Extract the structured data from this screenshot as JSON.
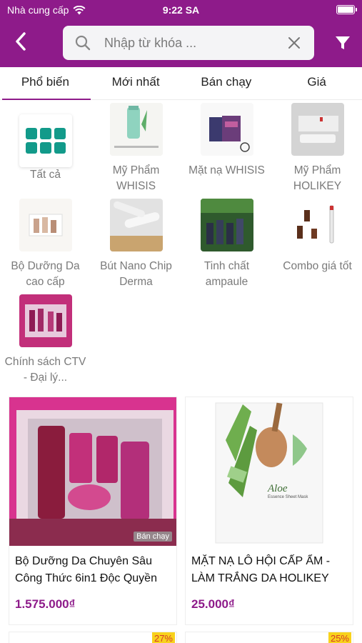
{
  "status": {
    "carrier": "Nhà cung cấp",
    "time": "9:22 SA"
  },
  "search": {
    "placeholder": "Nhập từ khóa ..."
  },
  "tabs": [
    {
      "label": "Phổ biến",
      "active": true
    },
    {
      "label": "Mới nhất",
      "active": false
    },
    {
      "label": "Bán chạy",
      "active": false
    },
    {
      "label": "Giá",
      "active": false
    }
  ],
  "categories": [
    {
      "label": "Tất cả",
      "icon": "grid-icon"
    },
    {
      "label": "Mỹ Phẩm WHISIS"
    },
    {
      "label": "Mặt nạ WHISIS"
    },
    {
      "label": "Mỹ Phẩm HOLIKEY"
    },
    {
      "label": "Bộ Dưỡng Da cao cấp"
    },
    {
      "label": "Bút Nano Chip Derma"
    },
    {
      "label": "Tinh chất ampaule"
    },
    {
      "label": "Combo giá tốt"
    },
    {
      "label": "Chính sách CTV - Đại lý..."
    }
  ],
  "products": [
    {
      "name": "Bộ Dưỡng Da Chuyên Sâu Công Thức 6in1 Độc Quyền",
      "price": "1.575.000₫",
      "tag": "Bán chạy",
      "image_text": []
    },
    {
      "name": "MẶT NẠ LÔ HỘI CẤP ẨM - LÀM TRẮNG DA HOLIKEY",
      "price": "25.000₫",
      "tag": "",
      "image_text": [
        "Aloe",
        "Essence Sheet Mask"
      ]
    },
    {
      "discount": "27%"
    },
    {
      "discount": "25%"
    }
  ],
  "colors": {
    "brand": "#8e1b8a",
    "accent": "#129a8a",
    "discount_bg": "#f8d21c"
  }
}
